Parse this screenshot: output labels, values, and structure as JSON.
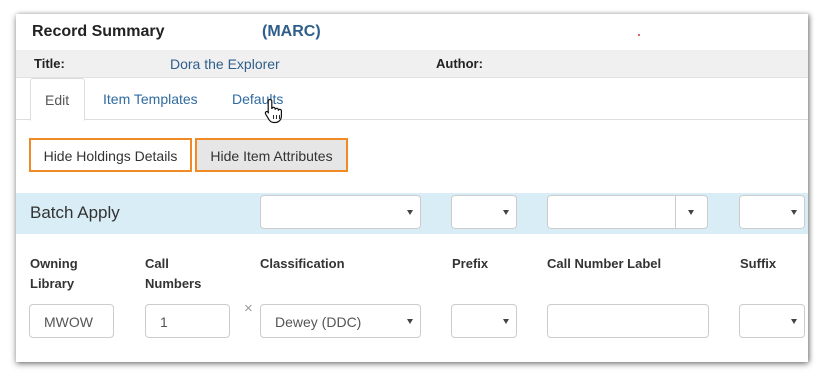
{
  "header": {
    "title": "Record Summary",
    "format_link": "(MARC)"
  },
  "record": {
    "title_label": "Title:",
    "title_value": "Dora the Explorer",
    "author_label": "Author:",
    "author_value": ""
  },
  "tabs": [
    {
      "label": "Edit",
      "active": true
    },
    {
      "label": "Item Templates",
      "active": false
    },
    {
      "label": "Defaults",
      "active": false
    }
  ],
  "toggles": {
    "holdings_label": "Hide Holdings Details",
    "attributes_label": "Hide Item Attributes",
    "highlight_color": "#f08a24"
  },
  "batch": {
    "label": "Batch Apply",
    "band_color": "#d9edf7"
  },
  "columns": {
    "owning_library": [
      "Owning",
      "Library"
    ],
    "call_numbers": [
      "Call",
      "Numbers"
    ],
    "classification": "Classification",
    "prefix": "Prefix",
    "call_number_label": "Call Number Label",
    "suffix": "Suffix"
  },
  "row": {
    "owning_library": "MWOW",
    "call_numbers": "1",
    "classification": "Dewey (DDC)",
    "prefix": "",
    "call_number_label": "",
    "suffix": ""
  },
  "icons": {
    "remove": "×"
  },
  "colors": {
    "link": "#2f5e8b",
    "accent": "#f08a24"
  }
}
